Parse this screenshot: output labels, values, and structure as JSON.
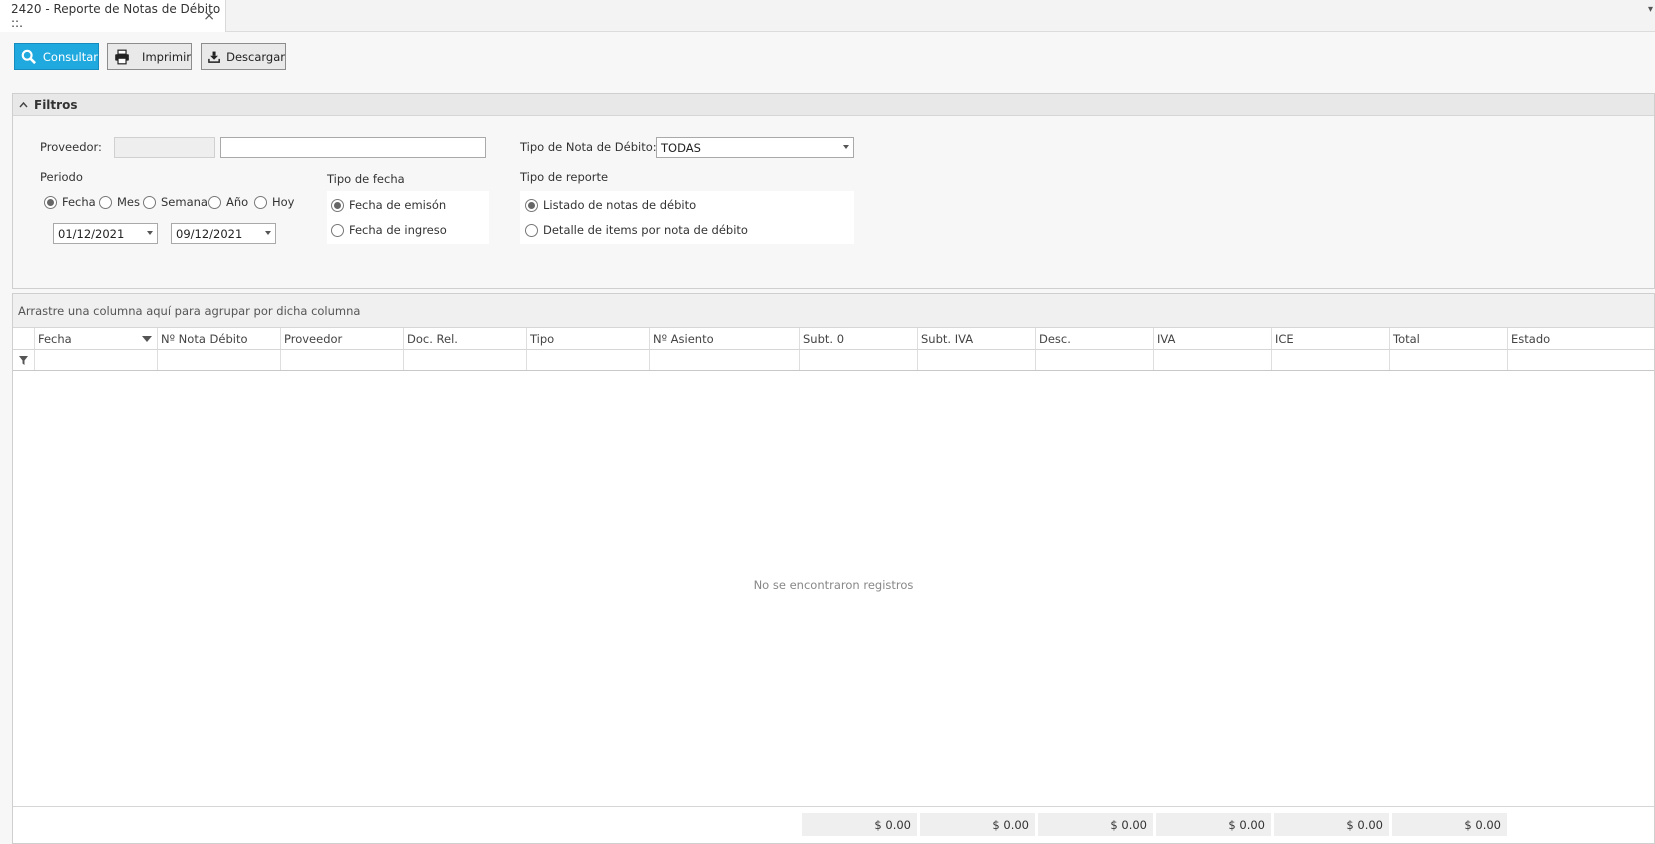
{
  "tab": {
    "title": "2420 - Reporte de Notas de Débito ::.",
    "close": "×",
    "overflow": "▾"
  },
  "toolbar": {
    "consultar": "Consultar",
    "imprimir": "Imprimir",
    "descargar": "Descargar"
  },
  "filters": {
    "title": "Filtros",
    "proveedor_label": "Proveedor:",
    "proveedor_code": "",
    "proveedor_name": "",
    "tipo_nota_label": "Tipo de Nota de Débito:",
    "tipo_nota_value": "TODAS",
    "periodo_label": "Periodo",
    "periodo_options": [
      "Fecha",
      "Mes",
      "Semana",
      "Año",
      "Hoy"
    ],
    "fecha_desde": "01/12/2021",
    "fecha_hasta": "09/12/2021",
    "tipo_fecha_label": "Tipo de fecha",
    "tipo_fecha_options": [
      "Fecha de emisón",
      "Fecha de ingreso"
    ],
    "tipo_reporte_label": "Tipo de reporte",
    "tipo_reporte_options": [
      "Listado de notas de débito",
      "Detalle de items por nota de débito"
    ]
  },
  "grid": {
    "group_hint": "Arrastre una columna aquí para agrupar por dicha columna",
    "columns": [
      "Fecha",
      "Nº Nota Débito",
      "Proveedor",
      "Doc. Rel.",
      "Tipo",
      "Nº Asiento",
      "Subt. 0",
      "Subt. IVA",
      "Desc.",
      "IVA",
      "ICE",
      "Total",
      "Estado"
    ],
    "empty_message": "No se encontraron registros",
    "totals": [
      "$ 0.00",
      "$ 0.00",
      "$ 0.00",
      "$ 0.00",
      "$ 0.00",
      "$ 0.00"
    ]
  },
  "colors": {
    "primary": "#1fa9df"
  }
}
